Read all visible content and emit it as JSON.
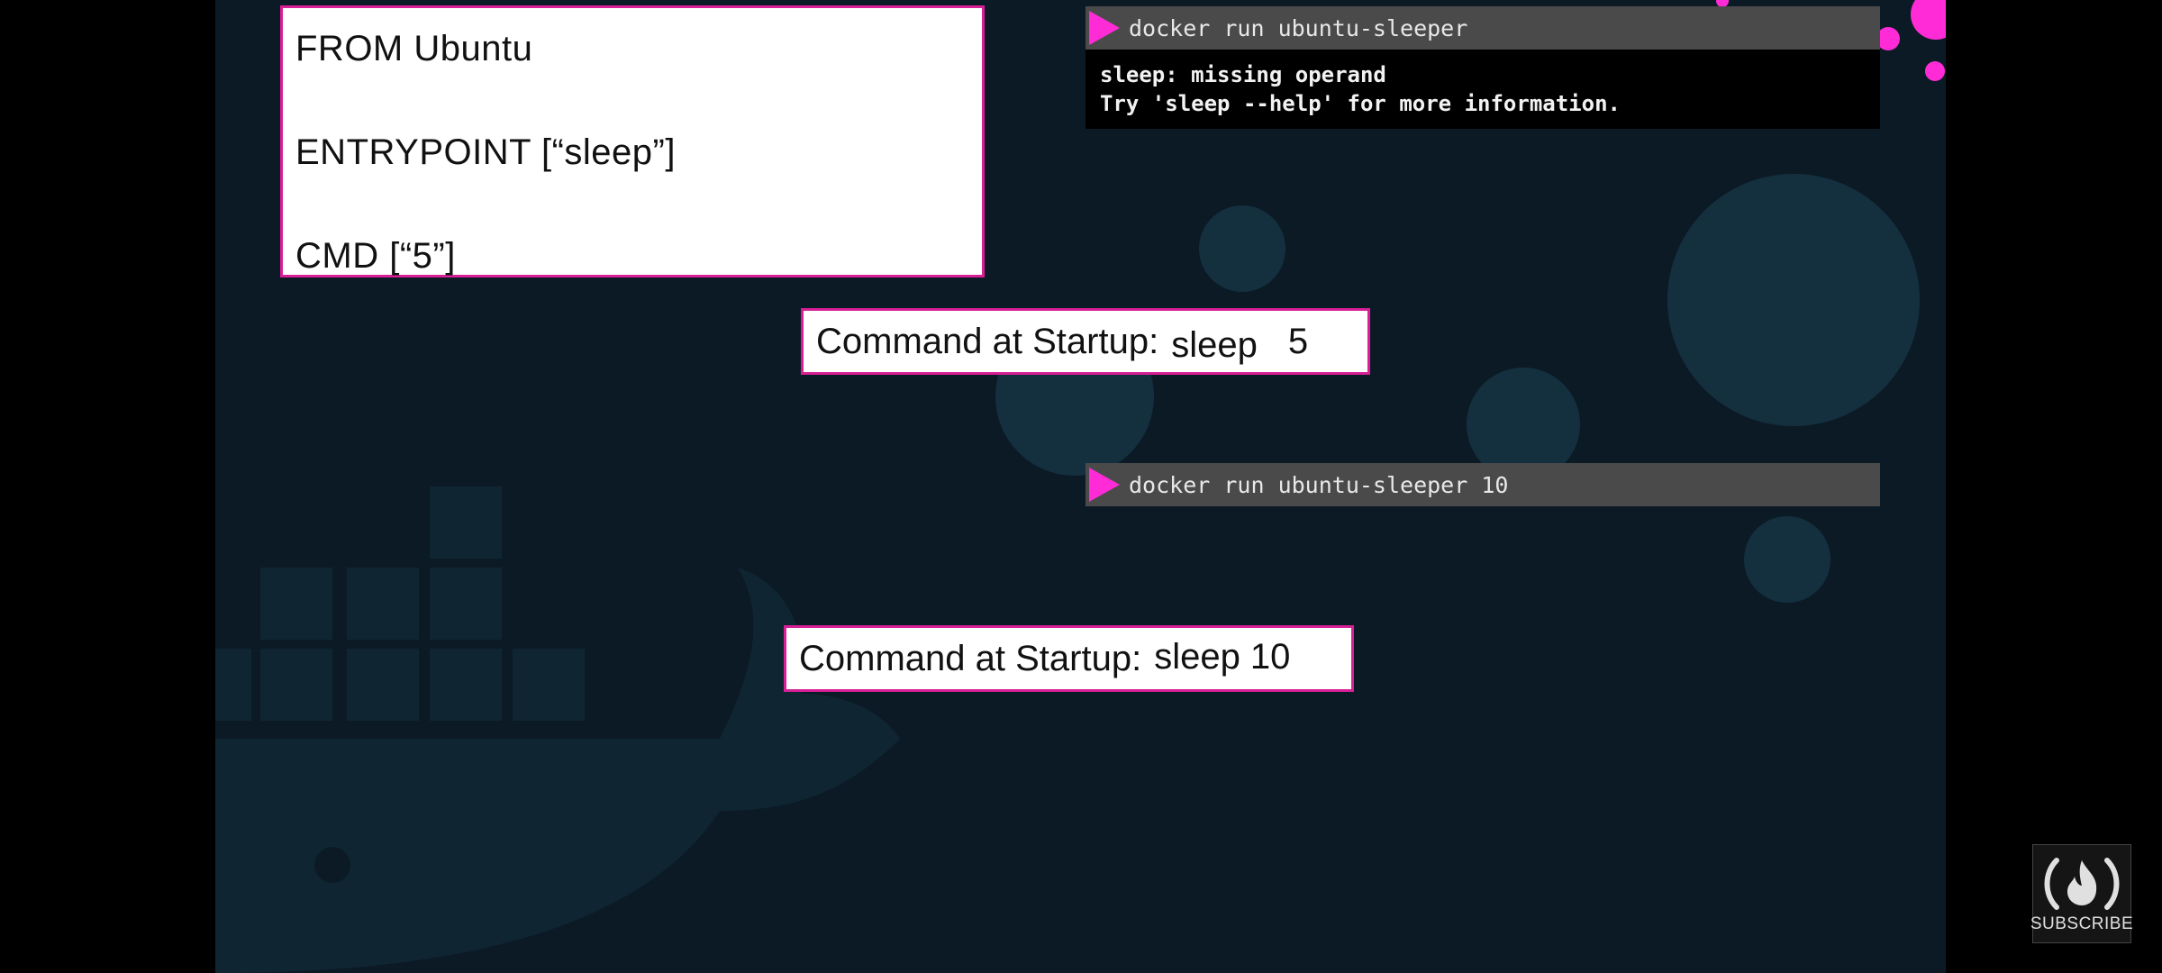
{
  "colors": {
    "background": "#0c1a26",
    "accent": "#ff2bd6",
    "box_border": "#d81f96",
    "terminal_bar": "#4a4a4a",
    "terminal_output_bg": "#000000"
  },
  "dockerfile": {
    "lines": [
      "FROM Ubuntu",
      "ENTRYPOINT [“sleep”]",
      "CMD [“5”]"
    ]
  },
  "terminal_1": {
    "prompt_icon": "play-triangle-icon",
    "command": "docker run ubuntu-sleeper",
    "output": [
      "sleep: missing operand",
      "Try 'sleep --help' for more information."
    ]
  },
  "startup_1": {
    "label": "Command at Startup:",
    "cmd": "sleep",
    "arg": "5"
  },
  "terminal_2": {
    "prompt_icon": "play-triangle-icon",
    "command": "docker run ubuntu-sleeper 10"
  },
  "startup_2": {
    "label": "Command at Startup:",
    "value": "sleep 10"
  },
  "subscribe": {
    "icon": "freecodecamp-flame-icon",
    "label": "SUBSCRIBE"
  }
}
